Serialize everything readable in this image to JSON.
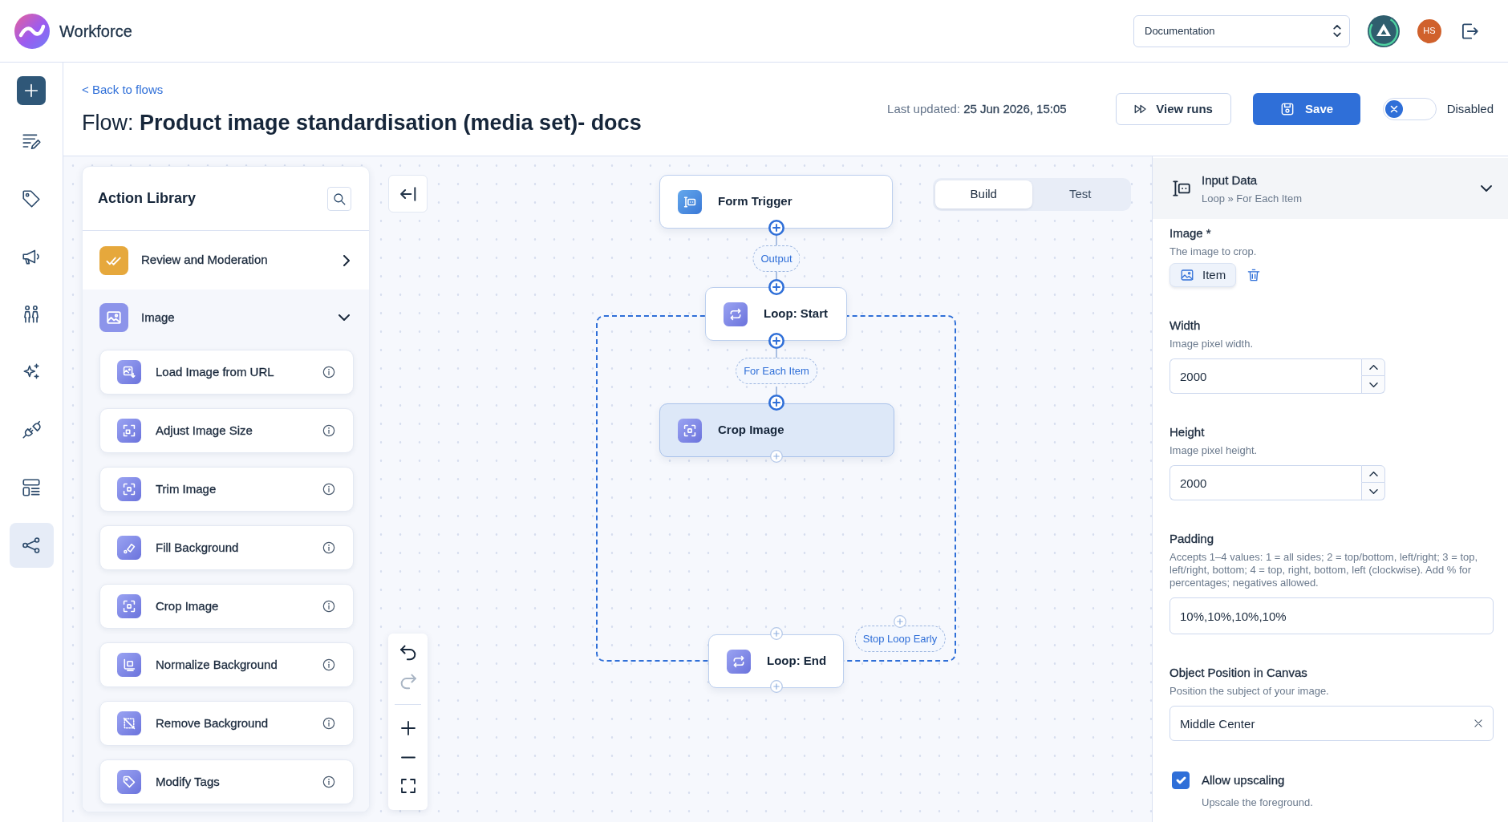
{
  "app": {
    "name": "Workforce"
  },
  "workspace_select": {
    "value": "Documentation"
  },
  "user": {
    "initials": "HS"
  },
  "rail": {
    "items": [
      {
        "selected": false
      },
      {
        "selected": false
      },
      {
        "selected": false
      },
      {
        "selected": false
      },
      {
        "selected": false
      },
      {
        "selected": false
      },
      {
        "selected": false
      },
      {
        "selected": true
      }
    ]
  },
  "header": {
    "back_link": "< Back to flows",
    "title": "Flow: **Product image standardisation (media set)- docs**",
    "last_updated": "Last updated: **25 Jun 2026, 15:05**",
    "buttons": [
      {
        "kind": "secondary",
        "label": "View runs"
      },
      {
        "kind": "primary",
        "label": "Save"
      }
    ],
    "status_toggle": {
      "on": false,
      "label": "Disabled"
    }
  },
  "action_library": {
    "title": "Action Library",
    "categories": [
      {
        "label": "Review and Moderation",
        "expanded": false,
        "color": "#e6a83c"
      },
      {
        "label": "Image",
        "expanded": true,
        "color": "#8c94ea",
        "items": [
          "Load Image from URL",
          "Adjust Image Size",
          "Trim Image",
          "Fill Background",
          "Crop Image",
          "Normalize Background",
          "Remove Background",
          "Modify Tags"
        ]
      }
    ]
  },
  "canvas": {
    "mode_tabs": [
      {
        "label": "Build",
        "selected": true
      },
      {
        "label": "Test",
        "selected": false
      }
    ],
    "nodes": [
      {
        "kind": "trigger",
        "label": "Form Trigger",
        "selected": false
      },
      {
        "kind": "loop",
        "label": "Loop: Start",
        "selected": false
      },
      {
        "kind": "action",
        "label": "Crop Image",
        "selected": true
      },
      {
        "kind": "loop",
        "label": "Loop: End",
        "selected": false
      }
    ],
    "edge_labels": [
      "Output",
      "For Each Item",
      "Stop Loop Early"
    ],
    "controls": [
      {
        "kind": "undo",
        "disabled": false
      },
      {
        "kind": "redo",
        "disabled": true
      },
      {
        "kind": "zoom_in",
        "disabled": false
      },
      {
        "kind": "zoom_out",
        "disabled": false
      },
      {
        "kind": "fit",
        "disabled": false
      }
    ]
  },
  "inspector": {
    "title": "Input Data",
    "breadcrumb": "Loop » For Each Item",
    "expanded": true,
    "fields": [
      {
        "kind": "reference",
        "label": "Image *",
        "description": "The image to crop.",
        "value": "Item"
      },
      {
        "kind": "number",
        "label": "Width",
        "description": "Image pixel width.",
        "value": "2000"
      },
      {
        "kind": "number",
        "label": "Height",
        "description": "Image pixel height.",
        "value": "2000"
      },
      {
        "kind": "text",
        "label": "Padding",
        "description": "Accepts 1–4 values: 1 = all sides; 2 = top/bottom, left/right; 3 = top, left/right, bottom; 4 = top, right, bottom, left (clockwise). Add % for percentages; negatives allowed.",
        "value": "10%,10%,10%,10%"
      },
      {
        "kind": "select",
        "label": "Object Position in Canvas",
        "description": "Position the subject of your image.",
        "value": "Middle Center"
      },
      {
        "kind": "checkbox",
        "label": "Allow upscaling",
        "description": "Upscale the foreground.",
        "checked": true
      }
    ]
  }
}
